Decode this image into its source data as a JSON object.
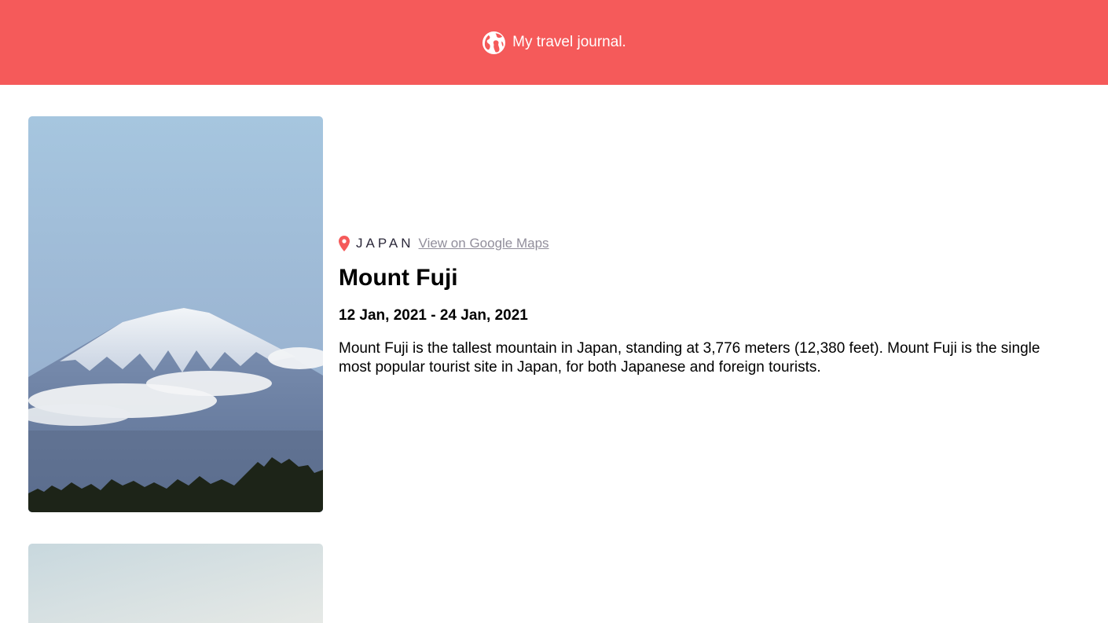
{
  "header": {
    "title": "My travel journal.",
    "icon": "globe-icon",
    "background_color": "#F55A5A"
  },
  "entries": [
    {
      "location": "JAPAN",
      "maps_link_label": "View on Google Maps",
      "title": "Mount Fuji",
      "dates": "12 Jan, 2021 - 24 Jan, 2021",
      "description": "Mount Fuji is the tallest mountain in Japan, standing at 3,776 meters (12,380 feet). Mount Fuji is the single most popular tourist site in Japan, for both Japanese and foreign tourists.",
      "pin_color": "#F55A5A"
    }
  ]
}
